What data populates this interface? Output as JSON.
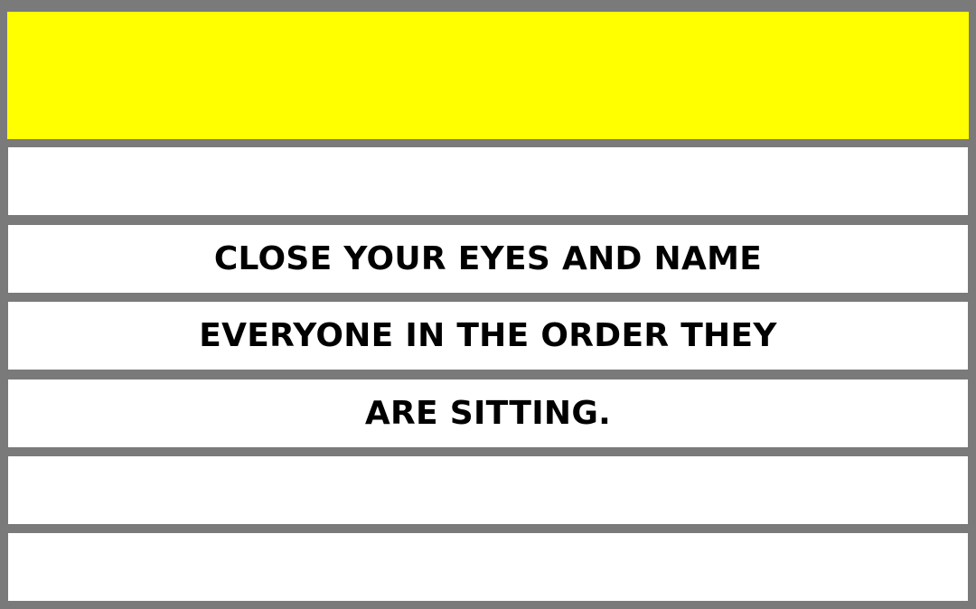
{
  "colors": {
    "frame": "#7a7a7a",
    "header_fill": "#ffff00",
    "row_fill": "#ffffff",
    "text": "#000000"
  },
  "header": {
    "text": ""
  },
  "rows": [
    {
      "text": ""
    },
    {
      "text": "CLOSE YOUR EYES AND NAME"
    },
    {
      "text": "EVERYONE IN THE ORDER THEY"
    },
    {
      "text": "ARE SITTING."
    },
    {
      "text": ""
    },
    {
      "text": ""
    }
  ]
}
